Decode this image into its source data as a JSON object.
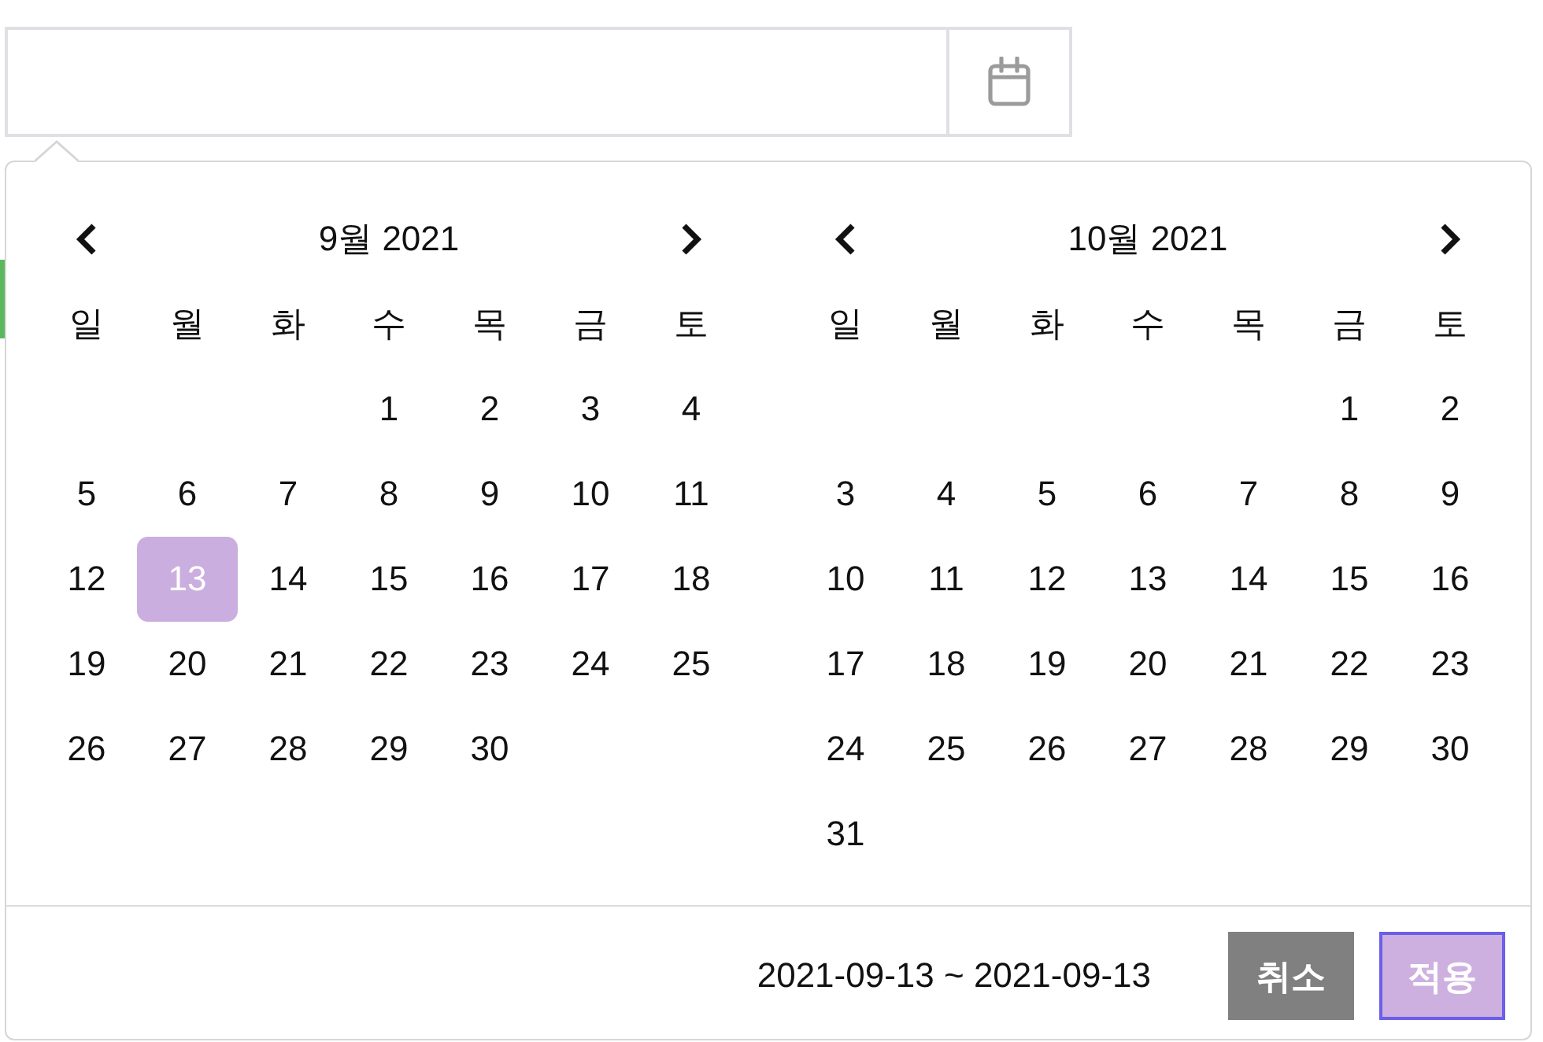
{
  "calendars": [
    {
      "title": "9월 2021",
      "weekdays": [
        "일",
        "월",
        "화",
        "수",
        "목",
        "금",
        "토"
      ],
      "weeks": [
        {
          "wed": {
            "day": "1",
            "selected": false
          },
          "thu": {
            "day": "2",
            "selected": false
          },
          "fri": {
            "day": "3",
            "selected": false
          },
          "sat": {
            "day": "4",
            "selected": false
          }
        },
        {
          "sun": {
            "day": "5",
            "selected": false
          },
          "mon": {
            "day": "6",
            "selected": false
          },
          "tue": {
            "day": "7",
            "selected": false
          },
          "wed": {
            "day": "8",
            "selected": false
          },
          "thu": {
            "day": "9",
            "selected": false
          },
          "fri": {
            "day": "10",
            "selected": false
          },
          "sat": {
            "day": "11",
            "selected": false
          }
        },
        {
          "sun": {
            "day": "12",
            "selected": false
          },
          "mon": {
            "day": "13",
            "selected": true
          },
          "tue": {
            "day": "14",
            "selected": false
          },
          "wed": {
            "day": "15",
            "selected": false
          },
          "thu": {
            "day": "16",
            "selected": false
          },
          "fri": {
            "day": "17",
            "selected": false
          },
          "sat": {
            "day": "18",
            "selected": false
          }
        },
        {
          "sun": {
            "day": "19",
            "selected": false
          },
          "mon": {
            "day": "20",
            "selected": false
          },
          "tue": {
            "day": "21",
            "selected": false
          },
          "wed": {
            "day": "22",
            "selected": false
          },
          "thu": {
            "day": "23",
            "selected": false
          },
          "fri": {
            "day": "24",
            "selected": false
          },
          "sat": {
            "day": "25",
            "selected": false
          }
        },
        {
          "sun": {
            "day": "26",
            "selected": false
          },
          "mon": {
            "day": "27",
            "selected": false
          },
          "tue": {
            "day": "28",
            "selected": false
          },
          "wed": {
            "day": "29",
            "selected": false
          },
          "thu": {
            "day": "30",
            "selected": false
          }
        }
      ]
    },
    {
      "title": "10월 2021",
      "weekdays": [
        "일",
        "월",
        "화",
        "수",
        "목",
        "금",
        "토"
      ],
      "weeks": [
        {
          "fri": {
            "day": "1",
            "selected": false
          },
          "sat": {
            "day": "2",
            "selected": false
          }
        },
        {
          "sun": {
            "day": "3",
            "selected": false
          },
          "mon": {
            "day": "4",
            "selected": false
          },
          "tue": {
            "day": "5",
            "selected": false
          },
          "wed": {
            "day": "6",
            "selected": false
          },
          "thu": {
            "day": "7",
            "selected": false
          },
          "fri": {
            "day": "8",
            "selected": false
          },
          "sat": {
            "day": "9",
            "selected": false
          }
        },
        {
          "sun": {
            "day": "10",
            "selected": false
          },
          "mon": {
            "day": "11",
            "selected": false
          },
          "tue": {
            "day": "12",
            "selected": false
          },
          "wed": {
            "day": "13",
            "selected": false
          },
          "thu": {
            "day": "14",
            "selected": false
          },
          "fri": {
            "day": "15",
            "selected": false
          },
          "sat": {
            "day": "16",
            "selected": false
          }
        },
        {
          "sun": {
            "day": "17",
            "selected": false
          },
          "mon": {
            "day": "18",
            "selected": false
          },
          "tue": {
            "day": "19",
            "selected": false
          },
          "wed": {
            "day": "20",
            "selected": false
          },
          "thu": {
            "day": "21",
            "selected": false
          },
          "fri": {
            "day": "22",
            "selected": false
          },
          "sat": {
            "day": "23",
            "selected": false
          }
        },
        {
          "sun": {
            "day": "24",
            "selected": false
          },
          "mon": {
            "day": "25",
            "selected": false
          },
          "tue": {
            "day": "26",
            "selected": false
          },
          "wed": {
            "day": "27",
            "selected": false
          },
          "thu": {
            "day": "28",
            "selected": false
          },
          "fri": {
            "day": "29",
            "selected": false
          },
          "sat": {
            "day": "30",
            "selected": false
          }
        },
        {
          "sun": {
            "day": "31",
            "selected": false
          }
        }
      ]
    }
  ],
  "footer": {
    "range": "2021-09-13 ~ 2021-09-13",
    "buttons": [
      {
        "label": "취소",
        "kind": "cancel"
      },
      {
        "label": "적용",
        "kind": "apply"
      }
    ]
  }
}
